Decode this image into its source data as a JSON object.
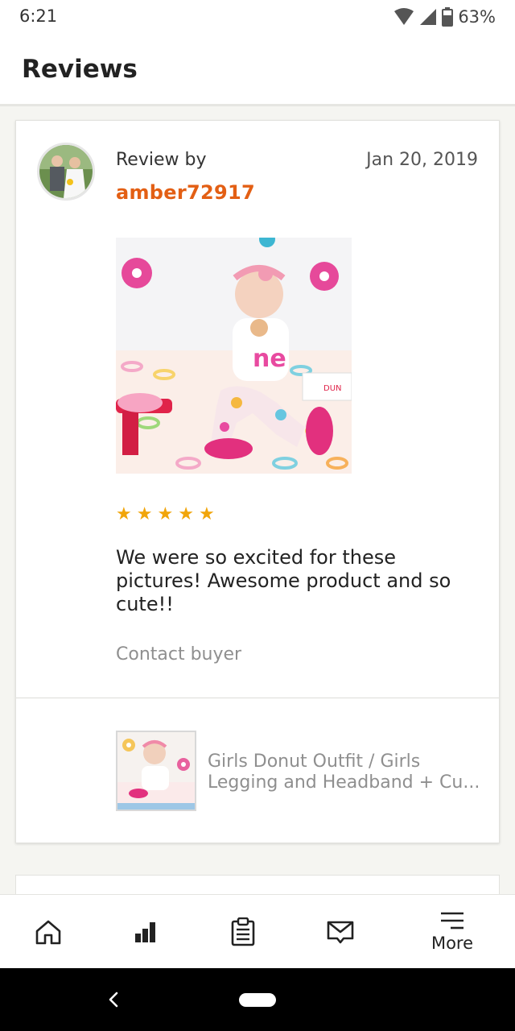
{
  "status_bar": {
    "time": "6:21",
    "battery": "63%"
  },
  "header": {
    "title": "Reviews"
  },
  "review": {
    "by_label": "Review by",
    "reviewer": "amber72917",
    "date": "Jan 20, 2019",
    "rating": 5,
    "stars": [
      "★",
      "★",
      "★",
      "★",
      "★"
    ],
    "text": "We were so excited for these pictures! Awesome product and so cute!!",
    "contact_label": "Contact buyer",
    "product_title": "Girls Donut Outfit / Girls Legging and Headband + Cu..."
  },
  "bottom_nav": {
    "items": [
      {
        "icon": "home-icon"
      },
      {
        "icon": "stats-icon"
      },
      {
        "icon": "orders-icon"
      },
      {
        "icon": "messages-icon"
      },
      {
        "icon": "menu-icon",
        "label": "More"
      }
    ]
  },
  "colors": {
    "accent": "#e35f14",
    "star": "#f1a50a"
  }
}
